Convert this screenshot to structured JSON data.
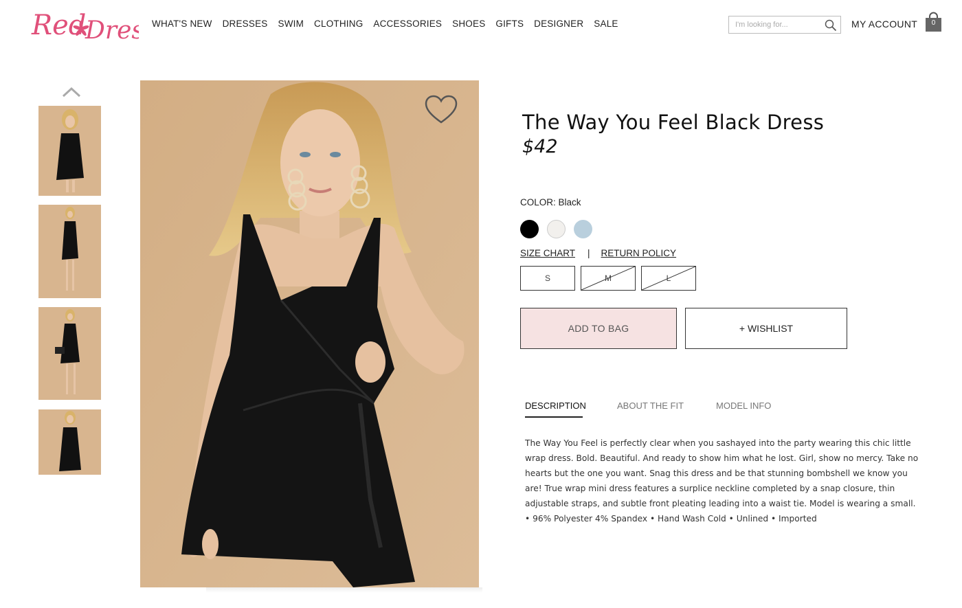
{
  "brand": {
    "logo_text": "Red Dress",
    "logo_color": "#e0507a"
  },
  "nav": {
    "items": [
      {
        "label": "WHAT'S NEW"
      },
      {
        "label": "DRESSES"
      },
      {
        "label": "SWIM"
      },
      {
        "label": "CLOTHING"
      },
      {
        "label": "ACCESSORIES"
      },
      {
        "label": "SHOES"
      },
      {
        "label": "GIFTS"
      },
      {
        "label": "DESIGNER"
      },
      {
        "label": "SALE"
      }
    ]
  },
  "search": {
    "placeholder": "I'm looking for...",
    "icon": "search-icon"
  },
  "account": {
    "label": "MY ACCOUNT"
  },
  "bag": {
    "count": "0",
    "icon": "shopping-bag-icon"
  },
  "gallery": {
    "up_icon": "chevron-up-icon",
    "wishlist_icon": "heart-icon"
  },
  "product": {
    "title": "The Way You Feel Black Dress",
    "price": "$42",
    "color_label": "COLOR: Black",
    "colors": [
      {
        "name": "Black",
        "hex": "#000000"
      },
      {
        "name": "White",
        "hex": "#f2f0ed"
      },
      {
        "name": "Light Blue",
        "hex": "#b9cfdd"
      }
    ],
    "size_chart_label": "SIZE CHART",
    "separator": "|",
    "return_policy_label": "RETURN POLICY",
    "sizes": [
      {
        "label": "S",
        "available": true
      },
      {
        "label": "M",
        "available": false
      },
      {
        "label": "L",
        "available": false
      }
    ],
    "add_to_bag_label": "ADD TO BAG",
    "wishlist_label": "+ WISHLIST"
  },
  "tabs": {
    "items": [
      {
        "label": "DESCRIPTION",
        "active": true
      },
      {
        "label": "ABOUT THE FIT",
        "active": false
      },
      {
        "label": "MODEL INFO",
        "active": false
      }
    ],
    "description": "The Way You Feel is perfectly clear when you sashayed into the party wearing this chic little wrap dress. Bold. Beautiful. And ready to show him what he lost. Girl, show no mercy. Take no hearts but the one you want. Snag this dress and be that stunning bombshell we know you are! True wrap mini dress features a surplice neckline completed by a snap closure, thin adjustable straps, and subtle front pleating leading into a waist tie. Model is wearing a small. • 96% Polyester 4% Spandex • Hand Wash Cold • Unlined • Imported"
  },
  "colors": {
    "accent_pink": "#f6e2e2",
    "logo_pink": "#e0507a",
    "photo_bg": "#d7b48c"
  }
}
